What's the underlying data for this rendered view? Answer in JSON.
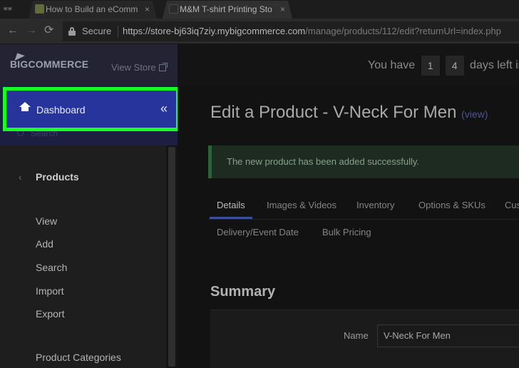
{
  "browser": {
    "tabs": [
      {
        "title": "How to Build an eComm"
      },
      {
        "title": "M&M T-shirt Printing Sto"
      }
    ],
    "close_glyph": "×",
    "nav": {
      "back": "←",
      "forward": "→",
      "reload": "⟳"
    },
    "secure_label": "Secure",
    "url_host": "https://store-bj63iq7ziy.mybigcommerce.com",
    "url_path": "/manage/products/112/edit?returnUrl=index.php"
  },
  "sidebar": {
    "logo_big": "BIG",
    "logo_commerce": "COMMERCE",
    "view_store": "View Store",
    "dashboard_label": "Dashboard",
    "collapse_glyph": "«",
    "search_label": "Search",
    "section_chevron": "‹",
    "section_title": "Products",
    "items": [
      "View",
      "Add",
      "Search",
      "Import",
      "Export",
      "Product Categories"
    ],
    "highlight_color": "#15ff24"
  },
  "header": {
    "trial_prefix": "You have",
    "days_1": "1",
    "days_2": "4",
    "trial_suffix": "days left in"
  },
  "main": {
    "title": "Edit a Product - V-Neck For Men",
    "view_link": "(view)",
    "alert": "The new product has been added successfully.",
    "tabs": [
      "Details",
      "Images & Videos",
      "Inventory",
      "Options & SKUs",
      "Cus"
    ],
    "tabs_row2": [
      "Delivery/Event Date",
      "Bulk Pricing"
    ],
    "summary_title": "Summary",
    "name_label": "Name",
    "name_value": "V-Neck For Men"
  }
}
